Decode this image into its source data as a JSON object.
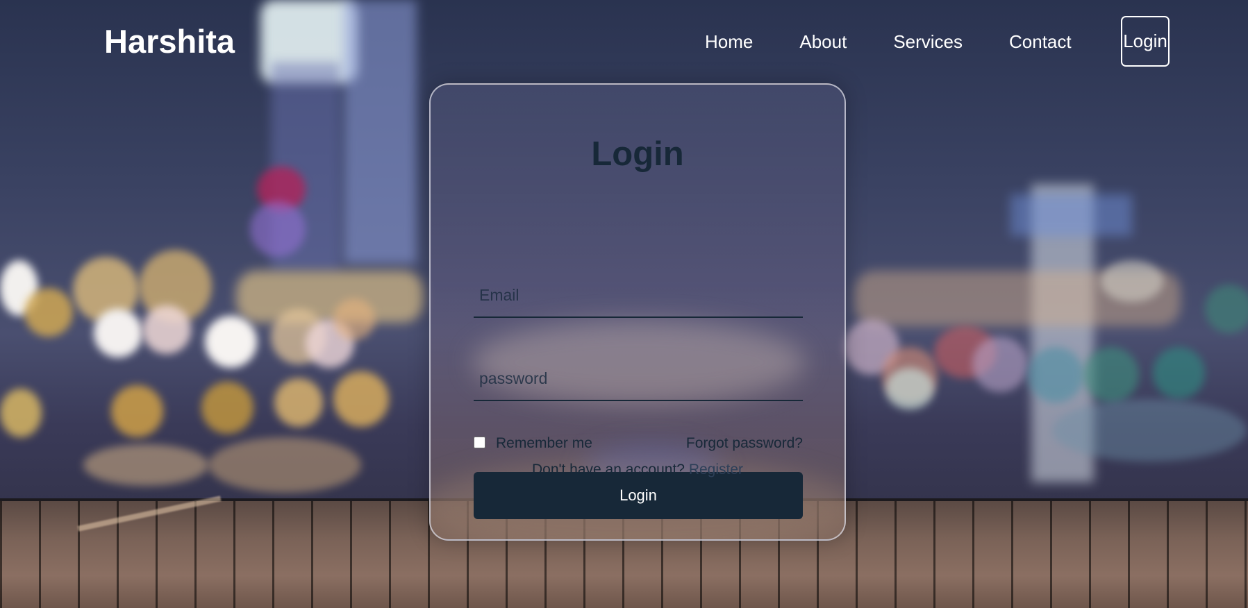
{
  "brand": {
    "name": "Harshita"
  },
  "nav": {
    "links": [
      {
        "label": "Home"
      },
      {
        "label": "About"
      },
      {
        "label": "Services"
      },
      {
        "label": "Contact"
      }
    ],
    "login_label": "Login"
  },
  "form": {
    "title": "Login",
    "email": {
      "placeholder": "Email",
      "value": ""
    },
    "password": {
      "placeholder": "password",
      "value": ""
    },
    "remember_label": "Remember me",
    "remember_checked": false,
    "forgot_label": "Forgot password?",
    "submit_label": "Login",
    "register_prompt": "Don't have an account?",
    "register_label": "Register"
  },
  "colors": {
    "primary": "#172838",
    "nav_text": "#ffffff"
  }
}
